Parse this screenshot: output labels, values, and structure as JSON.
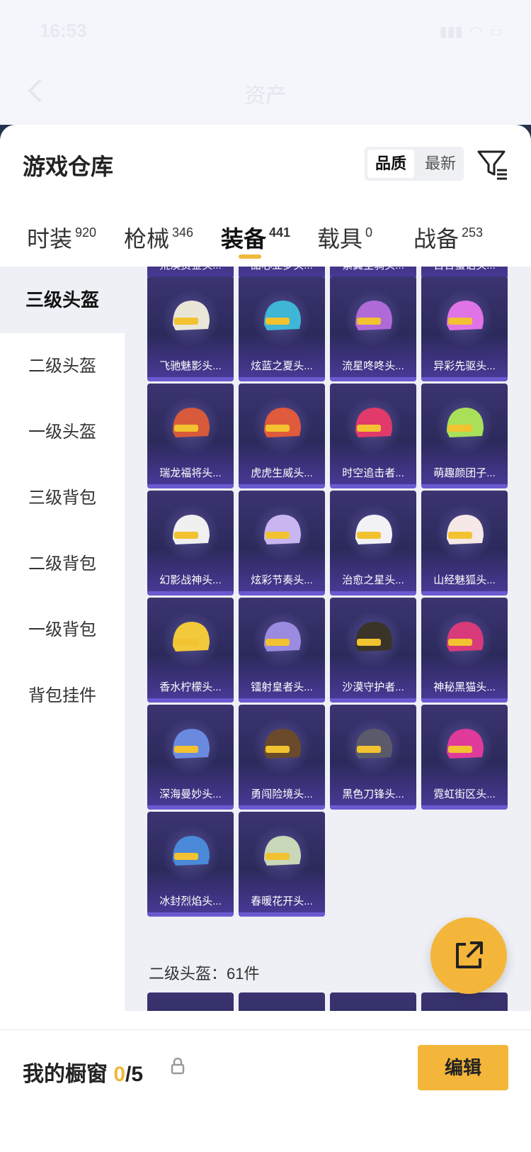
{
  "status": {
    "time": "16:53"
  },
  "header": {
    "title": "资产"
  },
  "sheet": {
    "title": "游戏仓库",
    "sort_options": [
      "品质",
      "最新"
    ],
    "active_sort": "品质"
  },
  "tabs": [
    {
      "label": "时装",
      "count": "920"
    },
    {
      "label": "枪械",
      "count": "346"
    },
    {
      "label": "装备",
      "count": "441"
    },
    {
      "label": "载具",
      "count": "0"
    },
    {
      "label": "战备",
      "count": "253"
    }
  ],
  "sidebar": [
    {
      "label": "三级头盔"
    },
    {
      "label": "二级头盔"
    },
    {
      "label": "一级头盔"
    },
    {
      "label": "三级背包"
    },
    {
      "label": "二级背包"
    },
    {
      "label": "一级背包"
    },
    {
      "label": "背包挂件"
    }
  ],
  "partial_row": [
    "荒漠赏金头...",
    "甜心亚梦头...",
    "紫翼圣骑头...",
    "百合蜜语头..."
  ],
  "items": [
    {
      "name": "飞驰魅影头...",
      "color": "#e9e6d8"
    },
    {
      "name": "炫蓝之夏头...",
      "color": "#3fb6d6"
    },
    {
      "name": "流星咚咚头...",
      "color": "#b06ad8"
    },
    {
      "name": "异彩先驱头...",
      "color": "#e074e6"
    },
    {
      "name": "瑞龙福将头...",
      "color": "#d85a3a"
    },
    {
      "name": "虎虎生威头...",
      "color": "#e05a3c"
    },
    {
      "name": "时空追击者...",
      "color": "#e23a6a"
    },
    {
      "name": "萌趣颜团子...",
      "color": "#a8e05a"
    },
    {
      "name": "幻影战神头...",
      "color": "#f0f0f0"
    },
    {
      "name": "炫彩节奏头...",
      "color": "#c9b6f0"
    },
    {
      "name": "治愈之星头...",
      "color": "#f2f2f6"
    },
    {
      "name": "山经魅狐头...",
      "color": "#f6e8e6"
    },
    {
      "name": "香水柠檬头...",
      "color": "#f2c93a"
    },
    {
      "name": "镭射皇者头...",
      "color": "#9a8ae0"
    },
    {
      "name": "沙漠守护者...",
      "color": "#3a3428"
    },
    {
      "name": "神秘黑猫头...",
      "color": "#d83a7a"
    },
    {
      "name": "深海曼妙头...",
      "color": "#6a8ae0"
    },
    {
      "name": "勇闯险境头...",
      "color": "#6a4a2a"
    },
    {
      "name": "黑色刀锋头...",
      "color": "#5a5a6a"
    },
    {
      "name": "霓虹街区头...",
      "color": "#e03a9a"
    },
    {
      "name": "冰封烈焰头...",
      "color": "#4a8ad8"
    },
    {
      "name": "春暖花开头...",
      "color": "#c8d8b8"
    }
  ],
  "section": {
    "label": "二级头盔：61件"
  },
  "bottom": {
    "label": "我的橱窗",
    "count_now": "0",
    "count_total": "/5",
    "edit_label": "编辑"
  },
  "colors": {
    "accent": "#f4b63a",
    "card_bg": "#2c2a5c"
  }
}
